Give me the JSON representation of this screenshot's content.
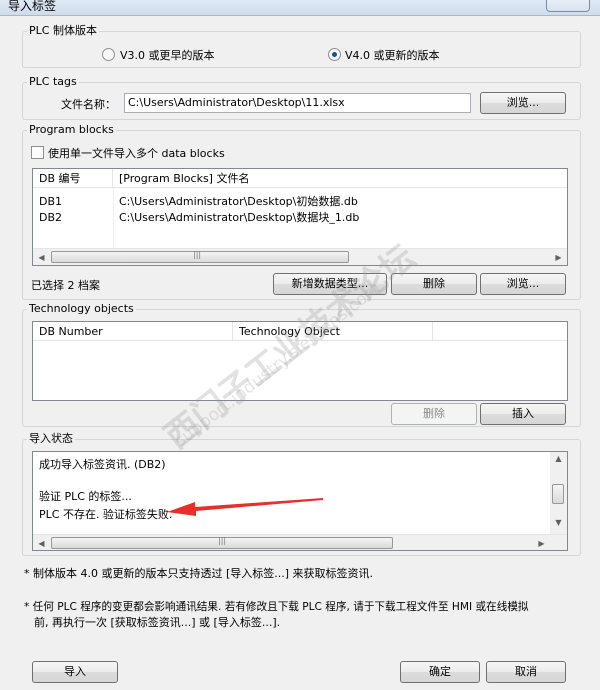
{
  "window": {
    "title": "导入标签"
  },
  "firmware": {
    "legend": "PLC 制体版本",
    "option_v3": "V3.0 或更早的版本",
    "option_v4": "V4.0 或更新的版本",
    "selected": "V4.0 或更新的版本"
  },
  "plc_tags": {
    "legend": "PLC tags",
    "file_label": "文件名称：",
    "file_value": "C:\\Users\\Administrator\\Desktop\\11.xlsx",
    "browse": "浏览..."
  },
  "program_blocks": {
    "legend": "Program blocks",
    "checkbox_label": "使用单一文件导入多个 data blocks",
    "columns": [
      "DB 编号",
      "[Program Blocks] 文件名"
    ],
    "rows": [
      {
        "db": "DB1",
        "file": "C:\\Users\\Administrator\\Desktop\\初始数据.db"
      },
      {
        "db": "DB2",
        "file": "C:\\Users\\Administrator\\Desktop\\数据块_1.db"
      }
    ],
    "selected_count": "已选择 2 档案",
    "add_type": "新增数据类型...",
    "delete": "删除",
    "browse": "浏览..."
  },
  "technology_objects": {
    "legend": "Technology objects",
    "columns": [
      "DB Number",
      "Technology Object"
    ],
    "delete": "删除",
    "insert": "插入"
  },
  "import_status": {
    "legend": "导入状态",
    "lines": [
      "成功导入标签资讯. (DB2)",
      "",
      "验证 PLC 的标签...",
      "PLC 不存在. 验证标签失败."
    ]
  },
  "notes": {
    "note1": "* 制体版本 4.0 或更新的版本只支持透过 [导入标签...] 来获取标签资讯.",
    "note2_line1": "* 任何 PLC 程序的变更都会影响通讯结果. 若有修改且下载 PLC 程序, 请于下载工程文件至 HMI 或在线模拟",
    "note2_line2": "前, 再执行一次 [获取标签资讯...] 或 [导入标签...]."
  },
  "footer": {
    "import": "导入",
    "ok": "确定",
    "cancel": "取消"
  },
  "watermark": {
    "line1": "西门子工业技术论坛",
    "line2": "support.industry.siemens.com"
  },
  "colors": {
    "arrow": "#e8302b",
    "window_bg": "#f0f0f0"
  }
}
